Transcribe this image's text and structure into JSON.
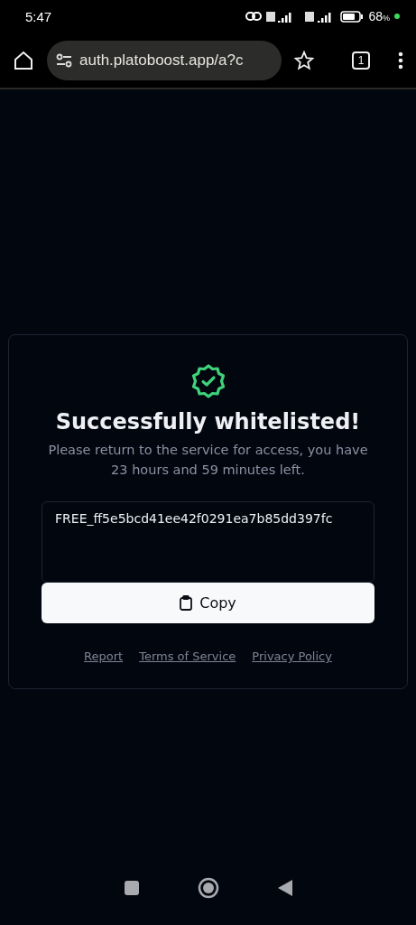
{
  "status_bar": {
    "time": "5:47",
    "battery": "68",
    "battery_unit": "%"
  },
  "browser": {
    "url": "auth.platoboost.app/a?c",
    "tab_count": "1"
  },
  "card": {
    "title": "Successfully whitelisted!",
    "message": "Please return to the service for access, you have 23 hours and 59 minutes left.",
    "key": "FREE_ff5e5bcd41ee42f0291ea7b85dd397fc",
    "copy_button": "Copy",
    "links": [
      "Report",
      "Terms of Service",
      "Privacy Policy"
    ]
  }
}
